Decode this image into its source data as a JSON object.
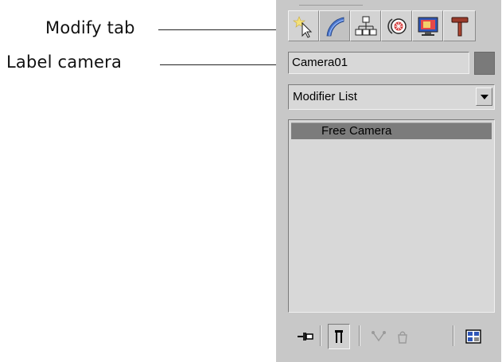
{
  "callouts": {
    "modify_tab": "Modify tab",
    "label_camera": "Label camera"
  },
  "command_panel": {
    "tabs": [
      {
        "name": "create",
        "icon": "create-star-cursor-icon"
      },
      {
        "name": "modify",
        "icon": "modify-bend-icon",
        "active": true
      },
      {
        "name": "hierarchy",
        "icon": "hierarchy-icon"
      },
      {
        "name": "motion",
        "icon": "motion-icon"
      },
      {
        "name": "display",
        "icon": "display-monitor-icon"
      },
      {
        "name": "utilities",
        "icon": "utilities-hammer-icon"
      }
    ],
    "object_name": "Camera01",
    "object_color": "#7a7a7a",
    "modifier_list": "Modifier List",
    "stack_items": [
      "Free Camera"
    ],
    "stack_tools": [
      {
        "name": "pin-stack",
        "icon": "pin-icon"
      },
      {
        "name": "show-end-result",
        "icon": "show-end-result-icon",
        "pressed": true
      },
      {
        "name": "make-unique",
        "icon": "make-unique-icon"
      },
      {
        "name": "remove-modifier",
        "icon": "remove-modifier-icon"
      },
      {
        "name": "configure-modifier-sets",
        "icon": "configure-sets-icon"
      }
    ]
  }
}
